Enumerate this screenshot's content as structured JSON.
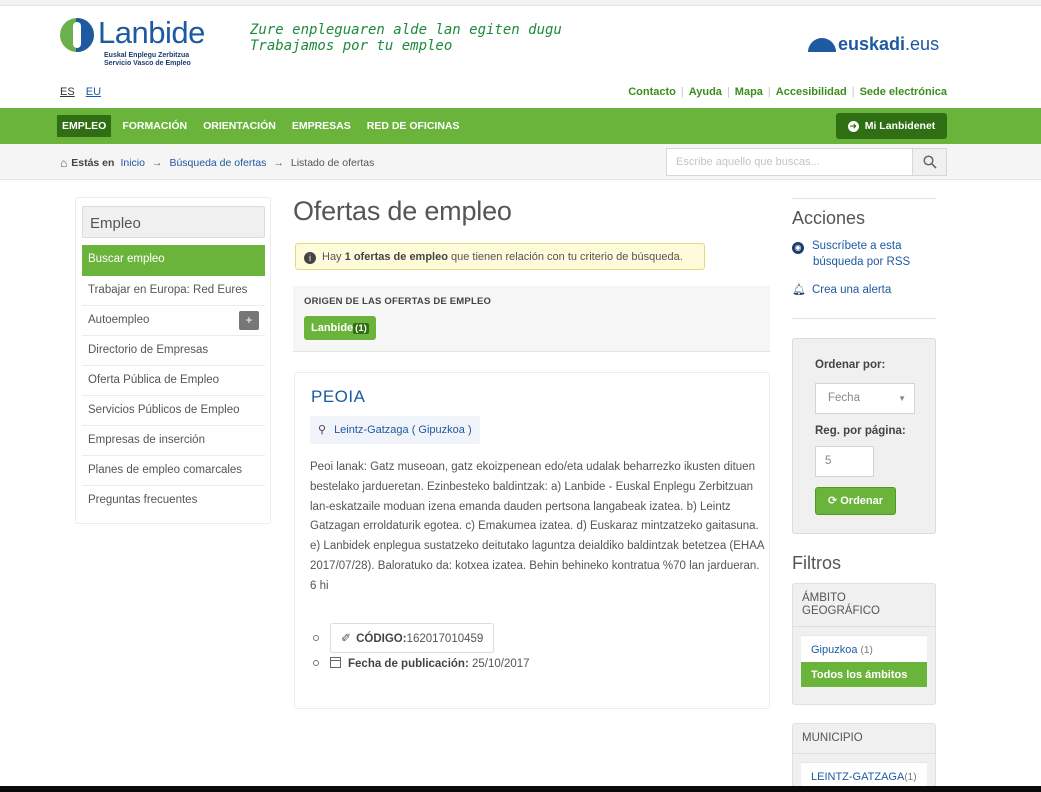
{
  "header": {
    "logo_name": "Lanbide",
    "logo_sub1": "Euskal Enplegu Zerbitzua",
    "logo_sub2": "Servicio Vasco de Empleo",
    "tagline_1": "Zure enpleguaren alde lan egiten dugu",
    "tagline_2": "Trabajamos por tu empleo",
    "euskadi_bold": "euskadi",
    "euskadi_rest": ".eus"
  },
  "languages": [
    {
      "label": "ES",
      "current": true
    },
    {
      "label": "EU",
      "current": false
    }
  ],
  "utility_links": [
    "Contacto",
    "Ayuda",
    "Mapa",
    "Accesibilidad",
    "Sede electrónica"
  ],
  "main_nav": {
    "items": [
      "EMPLEO",
      "FORMACIÓN",
      "ORIENTACIÓN",
      "EMPRESAS",
      "RED DE OFICINAS"
    ],
    "active": "EMPLEO",
    "account_button": "Mi Lanbidenet"
  },
  "breadcrumb": {
    "label": "Estás en",
    "items": [
      "Inicio",
      "Búsqueda de ofertas",
      "Listado de ofertas"
    ]
  },
  "search": {
    "placeholder": "Escribe aquello que buscas..."
  },
  "sidebar": {
    "heading": "Empleo",
    "items": [
      {
        "label": "Buscar empleo",
        "active": true
      },
      {
        "label": "Trabajar en Europa: Red Eures"
      },
      {
        "label": "Autoempleo",
        "expand": "+"
      },
      {
        "label": "Directorio de Empresas"
      },
      {
        "label": "Oferta Pública de Empleo"
      },
      {
        "label": "Servicios Públicos de Empleo"
      },
      {
        "label": "Empresas de inserción"
      },
      {
        "label": "Planes de empleo comarcales"
      },
      {
        "label": "Preguntas frecuentes"
      }
    ]
  },
  "main": {
    "title": "Ofertas de empleo",
    "alert": {
      "prefix": "Hay",
      "count": "1",
      "strong": "ofertas de empleo",
      "suffix": "que tienen relación con tu criterio de búsqueda."
    },
    "origin": {
      "title": "ORIGEN DE LAS OFERTAS DE EMPLEO",
      "tag": "Lanbide",
      "tag_count": "(1)"
    },
    "job": {
      "title": "PEOIA",
      "location": "Leintz-Gatzaga ( Gipuzkoa )",
      "description": "Peoi lanak: Gatz museoan, gatz ekoizpenean edo/eta udalak beharrezko ikusten dituen bestelako jardueretan. Ezinbesteko baldintzak: a) Lanbide - Euskal Enplegu Zerbitzuan lan-eskatzaile moduan izena emanda dauden pertsona langabeak izatea. b) Leintz Gatzagan erroldaturik egotea. c) Emakumea izatea. d) Euskaraz mintzatzeko gaitasuna. e) Lanbidek enplegua sustatzeko deitutako laguntza deialdiko baldintzak betetzea (EHAA 2017/07/28). Baloratuko da: kotxea izatea. Behin behineko kontratua %70 lan jardueran. 6 hi",
      "code_label": "CÓDIGO:",
      "code_value": "162017010459",
      "date_label": "Fecha de publicación:",
      "date_value": "25/10/2017"
    }
  },
  "right": {
    "actions_title": "Acciones",
    "rss_line1": "Suscríbete a esta",
    "rss_line2": "búsqueda por RSS",
    "alert_link": "Crea una alerta",
    "order": {
      "sort_label": "Ordenar por:",
      "sort_value": "Fecha",
      "per_page_label": "Reg. por página:",
      "per_page_value": "5",
      "button": "Ordenar"
    },
    "filters_title": "Filtros",
    "filter_geo": {
      "heading": "ÁMBITO GEOGRÁFICO",
      "item": "Gipuzkoa",
      "count": "(1)",
      "all": "Todos los ámbitos"
    },
    "filter_muni": {
      "heading": "MUNICIPIO",
      "item": "LEINTZ-GATZAGA",
      "count": "(1)"
    }
  },
  "colors": {
    "brand_green": "#6ab43c",
    "dark_green": "#2f6e12",
    "link_blue": "#1e5aa0"
  }
}
